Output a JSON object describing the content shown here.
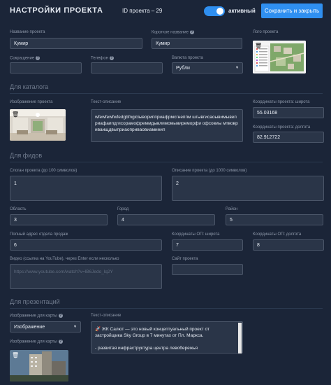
{
  "header": {
    "title": "НАСТРОЙКИ ПРОЕКТА",
    "project_id": "ID проекта – 29",
    "toggle_label": "активный",
    "save_label": "Сохранить и закрыть"
  },
  "general": {
    "name_label": "Название проекта",
    "name_value": "Кумир",
    "short_name_label": "Короткое название",
    "short_name_value": "Кумир",
    "logo_label": "Лого проекта",
    "abbr_label": "Сокращение",
    "abbr_value": "",
    "phone_label": "Телефон",
    "phone_value": "",
    "currency_label": "Валюта проекта",
    "currency_value": "Рубли"
  },
  "catalog": {
    "section_title": "Для каталога",
    "image_label": "Изображение проекта",
    "description_label": "Текст-описание",
    "description_value": "wfewfewfwfedgbfngiciыворипприафрмсгнеппм шгывгисаоывимывеприафаипдгисорамофреммдывлимомывиреморфи офсовиы мтвовриваищдвыприаоприваовиамиеип",
    "lat_label": "Координаты проекта: широта",
    "lat_value": "55.03168",
    "lon_label": "Координаты проекта: долгота",
    "lon_value": "82.912722"
  },
  "feeds": {
    "section_title": "Для фидов",
    "slogan_label": "Слоган проекта (до 100 символов)",
    "slogan_value": "1",
    "desc_label": "Описание проекта (до 1000 символов)",
    "desc_value": "2",
    "region_label": "Область",
    "region_value": "3",
    "city_label": "Город",
    "city_value": "4",
    "district_label": "Район",
    "district_value": "5",
    "address_label": "Полный адрес отдела продаж",
    "address_value": "6",
    "op_lat_label": "Координаты ОП: широта",
    "op_lat_value": "7",
    "op_lon_label": "Координаты ОП: долгота",
    "op_lon_value": "8",
    "video_label": "Видео (ссылка на YouTube), через Enter если несколько",
    "video_placeholder": "https://www.youtube.com/watch?v=lB6Jedo_lq2Y",
    "site_label": "Сайт проекта",
    "site_value": ""
  },
  "presentation": {
    "section_title": "Для презентаций",
    "map_image_label": "Изображение для карты",
    "map_image_select": "Изображение",
    "map_image_label2": "Изображение для карты",
    "text_label": "Текст-описание",
    "text_line1": "🚀 ЖК Салют — это новый концептуальный проект от",
    "text_line2": "застройщика Sky Group в 7 минутах от Пл. Маркса.",
    "text_line3": "",
    "text_line4": "- развитая инфраструктура центра левобережья"
  },
  "icons": {
    "delete": "trash-icon",
    "help": "question-icon",
    "dropdown": "chevron-down-icon"
  },
  "colors": {
    "background": "#1b2538",
    "accent": "#2f8ff0",
    "input_bg": "#2a3548"
  }
}
